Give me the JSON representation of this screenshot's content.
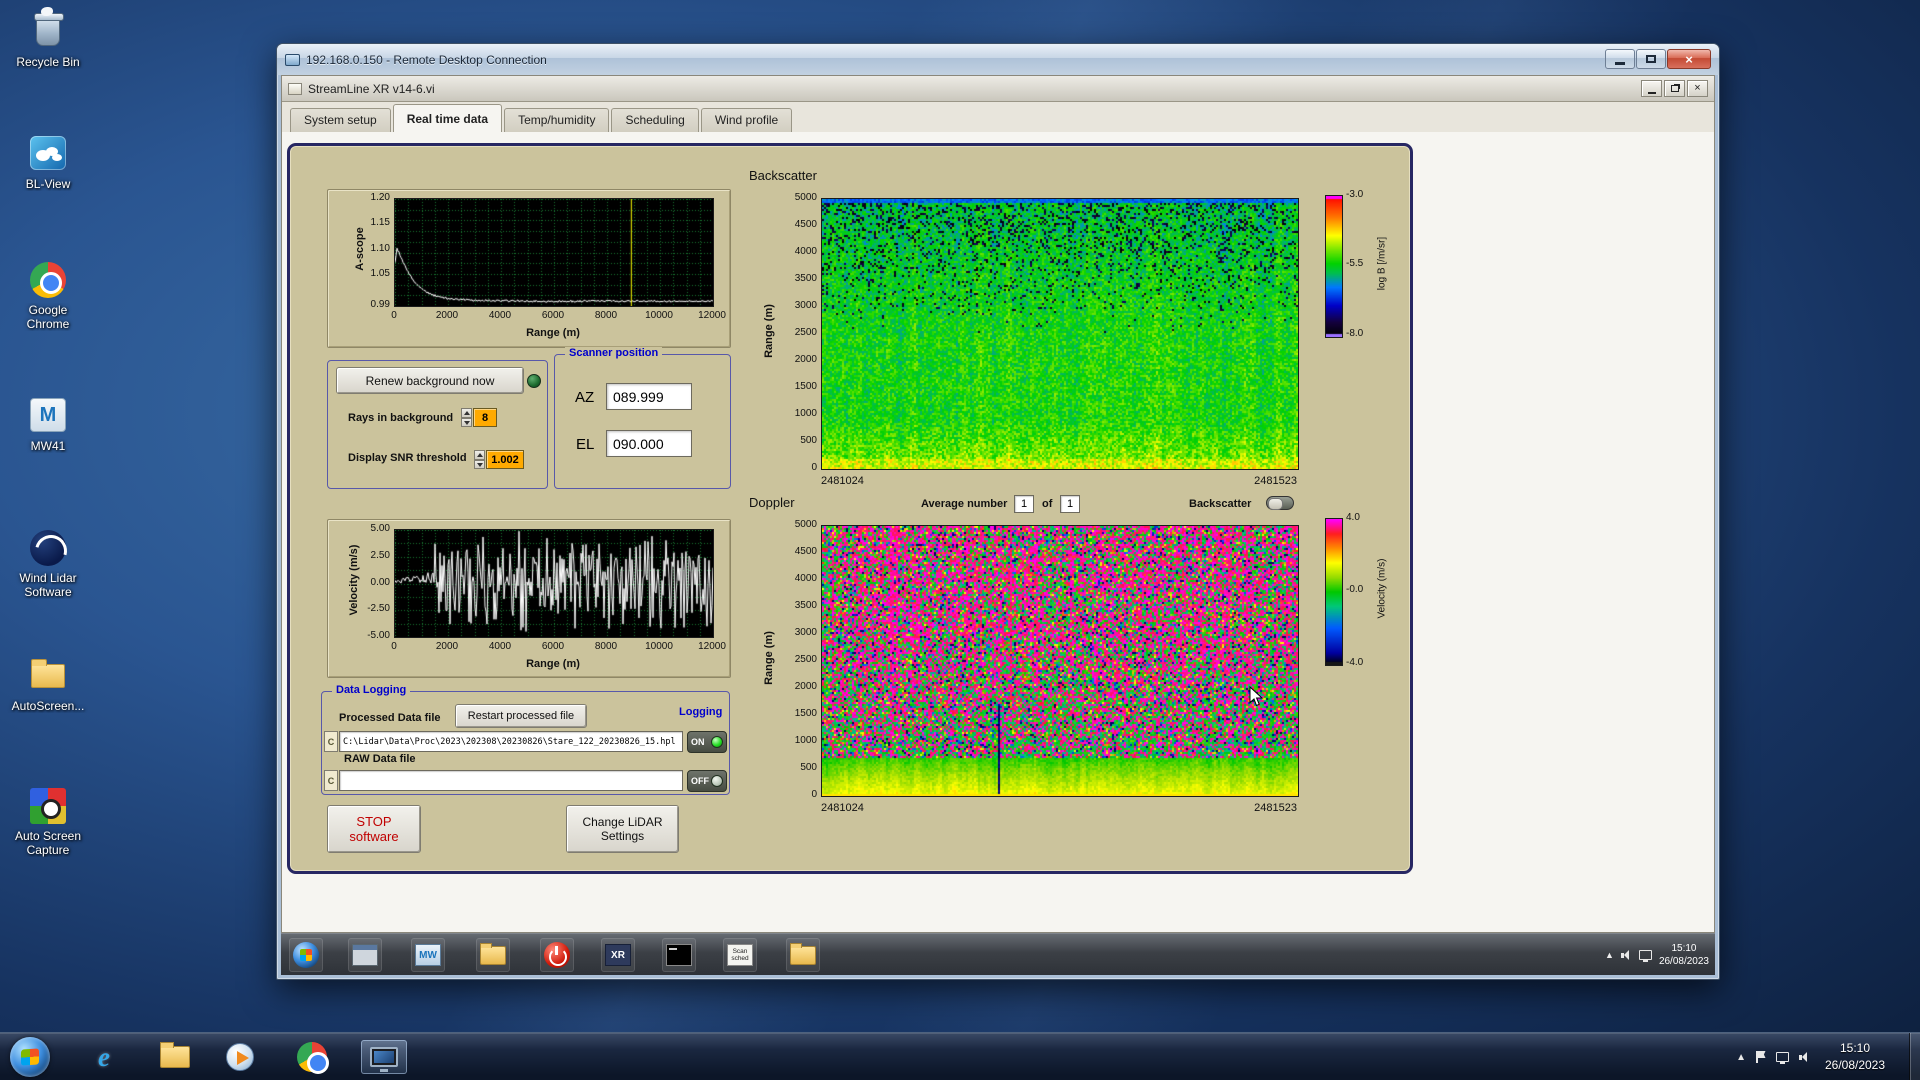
{
  "desktop": {
    "icons": [
      {
        "name": "recycle-bin",
        "label": "Recycle Bin"
      },
      {
        "name": "bl-view",
        "label": "BL-View"
      },
      {
        "name": "google-chrome",
        "label": "Google Chrome"
      },
      {
        "name": "mw41",
        "label": "MW41"
      },
      {
        "name": "wind-lidar-software",
        "label": "Wind Lidar Software"
      },
      {
        "name": "autoscreen",
        "label": "AutoScreen..."
      },
      {
        "name": "auto-screen-capture",
        "label": "Auto Screen Capture"
      }
    ]
  },
  "host_taskbar": {
    "time": "15:10",
    "date": "26/08/2023"
  },
  "rdp": {
    "title": "192.168.0.150 - Remote Desktop Connection"
  },
  "vi": {
    "title": "StreamLine XR v14-6.vi",
    "tabs": [
      "System setup",
      "Real time data",
      "Temp/humidity",
      "Scheduling",
      "Wind profile"
    ],
    "active_tab": "Real time data"
  },
  "remote_taskbar": {
    "time": "15:10",
    "date": "26/08/2023",
    "icon_text_xr": "XR",
    "icon_text_scan": "Scan sched"
  },
  "panel": {
    "renew_button": "Renew background now",
    "rays_label": "Rays in background",
    "rays_value": "8",
    "snr_label": "Display SNR threshold",
    "snr_value": "1.002",
    "scanner": {
      "title": "Scanner position",
      "az_label": "AZ",
      "az_value": "089.999",
      "el_label": "EL",
      "el_value": "090.000"
    },
    "backscatter_heading": "Backscatter",
    "doppler_heading": "Doppler",
    "average_label": "Average number",
    "average_value": "1",
    "of_label": "of",
    "of_count": "1",
    "backscatter_toggle_label": "Backscatter",
    "logging": {
      "title": "Data Logging",
      "processed_label": "Processed Data file",
      "restart_button": "Restart processed file",
      "logging_label": "Logging",
      "drive_letter": "C",
      "processed_path": "C:\\Lidar\\Data\\Proc\\2023\\202308\\20230826\\Stare_122_20230826_15.hpl",
      "raw_label": "RAW Data file",
      "raw_path": "",
      "on_label": "ON",
      "off_label": "OFF"
    },
    "stop_line1": "STOP",
    "stop_line2": "software",
    "change_line1": "Change LiDAR",
    "change_line2": "Settings"
  },
  "chart_data": [
    {
      "id": "ascope",
      "type": "line",
      "xlabel": "Range (m)",
      "ylabel": "A-scope",
      "xlim": [
        0,
        12000
      ],
      "ylim": [
        0.99,
        1.2
      ],
      "xticks": [
        0,
        2000,
        4000,
        6000,
        8000,
        10000,
        12000
      ],
      "yticks": [
        "1.20",
        "1.15",
        "1.10",
        "1.05",
        "0.99"
      ],
      "cursor_x": 8900,
      "cursor_color": "#ffff00",
      "line_color": "#ffffff",
      "x": [
        0,
        60,
        150,
        250,
        350,
        500,
        700,
        900,
        1100,
        1400,
        1800,
        2200,
        3000,
        4000,
        5000,
        6000,
        8000,
        10000,
        12000
      ],
      "y": [
        1.075,
        1.1,
        1.095,
        1.085,
        1.07,
        1.055,
        1.04,
        1.03,
        1.02,
        1.012,
        1.006,
        1.003,
        1.001,
        1.0,
        1.0,
        0.999,
        1.0,
        0.999,
        1.0
      ]
    },
    {
      "id": "velocity",
      "type": "line",
      "xlabel": "Range (m)",
      "ylabel": "Velocity (m/s)",
      "xlim": [
        0,
        12000
      ],
      "ylim": [
        -5,
        5
      ],
      "xticks": [
        0,
        2000,
        4000,
        6000,
        8000,
        10000,
        12000
      ],
      "yticks": [
        "5.00",
        "2.50",
        "0.00",
        "-2.50",
        "-5.00"
      ],
      "coherent_range_m": 1500,
      "noise_seed": 12345,
      "line_color": "#ffffff",
      "description": "coherent low velocity signal below ~1500 m, uncorrelated noise filling +/-5 m/s beyond"
    },
    {
      "id": "backscatter",
      "type": "heatmap",
      "title": "Backscatter",
      "ylabel": "Range (m)",
      "ylim": [
        0,
        5000
      ],
      "yticks": [
        5000,
        4500,
        4000,
        3500,
        3000,
        2500,
        2000,
        1500,
        1000,
        500,
        0
      ],
      "x_start_label": "2481024",
      "x_end_label": "2481523",
      "colorbar_label": "log B [/m/sr]",
      "colorbar_ticks": [
        "-3.0",
        "-5.5",
        "-8.0"
      ],
      "value_range": [
        -8.0,
        -3.0
      ],
      "mean_value": -5.4,
      "noise_seed": 77
    },
    {
      "id": "doppler",
      "type": "heatmap",
      "title": "Doppler",
      "ylabel": "Range (m)",
      "ylim": [
        0,
        5000
      ],
      "yticks": [
        5000,
        4500,
        4000,
        3500,
        3000,
        2500,
        2000,
        1500,
        1000,
        500,
        0
      ],
      "x_start_label": "2481024",
      "x_end_label": "2481523",
      "colorbar_label": "Velocity (m/s)",
      "colorbar_ticks": [
        "4.0",
        "-0.0",
        "-4.0"
      ],
      "value_range": [
        -4.0,
        4.0
      ],
      "noise_seed": 99
    }
  ]
}
